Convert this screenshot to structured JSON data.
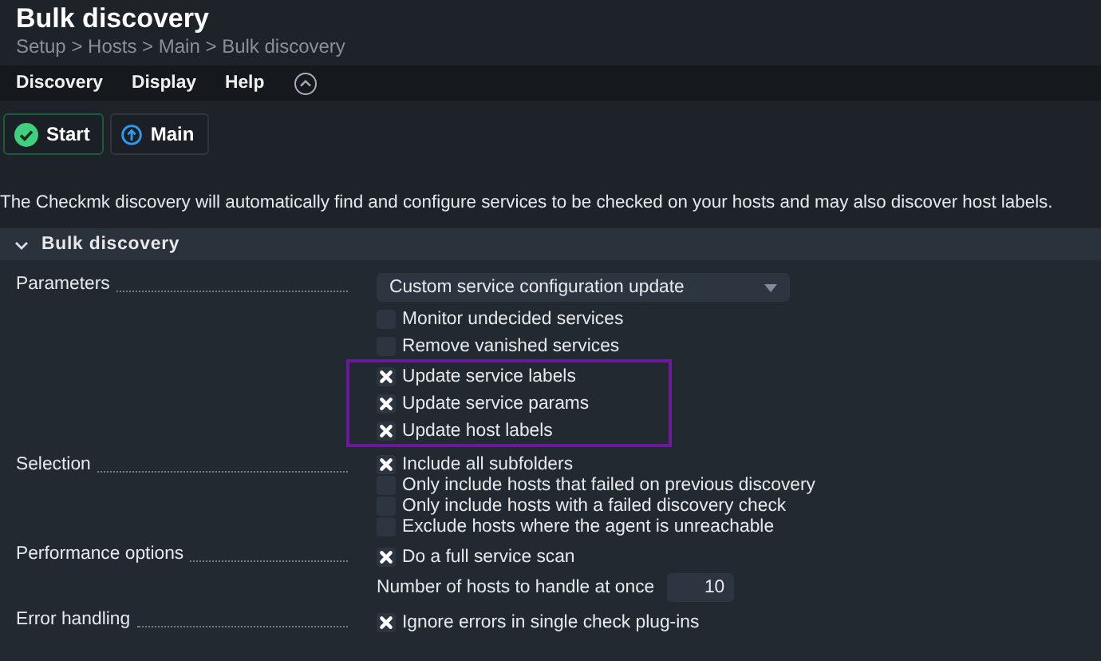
{
  "page": {
    "title": "Bulk discovery",
    "breadcrumb": "Setup > Hosts > Main > Bulk discovery"
  },
  "menu": [
    "Discovery",
    "Display",
    "Help"
  ],
  "buttons": [
    {
      "label": "Start",
      "kind": "start"
    },
    {
      "label": "Main",
      "kind": "up"
    }
  ],
  "description": "The Checkmk discovery will automatically find and configure services to be checked on your hosts and may also discover host labels.",
  "section": {
    "title": "Bulk discovery",
    "expanded": true
  },
  "parameters": {
    "label": "Parameters",
    "dropdown": "Custom service configuration update",
    "options": [
      {
        "label": "Monitor undecided services",
        "checked": false
      },
      {
        "label": "Remove vanished services",
        "checked": false
      }
    ],
    "highlighted_options": [
      {
        "label": "Update service labels",
        "checked": true
      },
      {
        "label": "Update service params",
        "checked": true
      },
      {
        "label": "Update host labels",
        "checked": true
      }
    ]
  },
  "selection": {
    "label": "Selection",
    "options": [
      {
        "label": "Include all subfolders",
        "checked": true
      },
      {
        "label": "Only include hosts that failed on previous discovery",
        "checked": false
      },
      {
        "label": "Only include hosts with a failed discovery check",
        "checked": false
      },
      {
        "label": "Exclude hosts where the agent is unreachable",
        "checked": false
      }
    ]
  },
  "performance": {
    "label": "Performance options",
    "options": [
      {
        "label": "Do a full service scan",
        "checked": true
      }
    ],
    "hosts_label": "Number of hosts to handle at once",
    "hosts_value": "10"
  },
  "errors": {
    "label": "Error handling",
    "options": [
      {
        "label": "Ignore errors in single check plug-ins",
        "checked": true
      }
    ]
  }
}
